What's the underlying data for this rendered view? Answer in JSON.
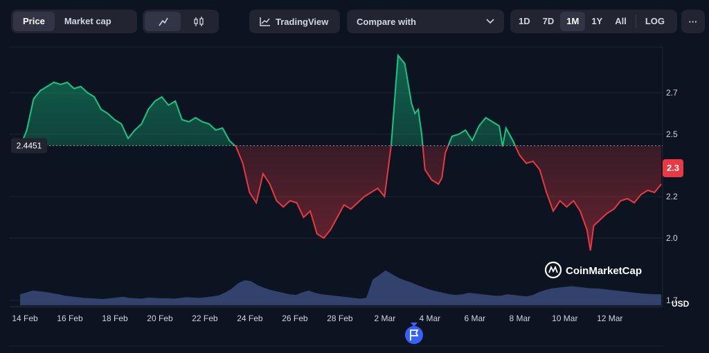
{
  "toolbar": {
    "price_label": "Price",
    "market_cap_label": "Market cap",
    "tradingview_label": "TradingView",
    "compare_placeholder": "Compare with",
    "ranges": [
      "1D",
      "7D",
      "1M",
      "1Y",
      "All"
    ],
    "active_range": "1M",
    "log_label": "LOG",
    "more_label": "···"
  },
  "colors": {
    "up": "#16c784",
    "down": "#ea3943",
    "volume": "#3a4a7a",
    "flag": "#3861fb"
  },
  "watermark": "CoinMarketCap",
  "chart_data": {
    "type": "area",
    "baseline": 2.4451,
    "baseline_label": "2.4451",
    "current_label": "2.3",
    "currency_label": "USD",
    "y_ticks": [
      2.0,
      2.2,
      2.5,
      2.7,
      1.7
    ],
    "y_tick_labels": [
      "2.0",
      "2.2",
      "2.5",
      "2.7",
      "1.7"
    ],
    "ylim": [
      1.68,
      2.92
    ],
    "x_tick_labels": [
      "14 Feb",
      "16 Feb",
      "18 Feb",
      "20 Feb",
      "22 Feb",
      "24 Feb",
      "26 Feb",
      "28 Feb",
      "2 Mar",
      "4 Mar",
      "6 Mar",
      "8 Mar",
      "10 Mar",
      "12 Mar"
    ],
    "x_range_days": [
      0,
      28.5
    ],
    "series": [
      {
        "x": [
          0,
          0.3,
          0.6,
          0.9,
          1.2,
          1.5,
          1.8,
          2.1,
          2.4,
          2.7,
          3.0,
          3.3,
          3.6,
          3.9,
          4.2,
          4.5,
          4.8,
          5.1,
          5.4,
          5.7,
          6.0,
          6.3,
          6.6,
          6.9,
          7.2,
          7.5,
          7.8,
          8.1,
          8.4,
          8.7,
          9.0,
          9.3,
          9.6,
          9.9,
          10.2,
          10.5,
          10.8,
          11.1,
          11.4,
          11.7,
          12.0,
          12.3,
          12.6,
          12.9,
          13.2,
          13.5,
          13.8,
          14.1,
          14.4,
          14.7,
          15.0,
          15.3,
          15.6,
          15.9,
          16.2,
          16.5,
          16.8,
          17.1,
          17.4,
          17.55,
          17.7,
          17.85,
          18.0,
          18.3,
          18.6,
          18.75,
          18.9,
          19.2,
          19.5,
          19.8,
          20.1,
          20.4,
          20.7,
          21.0,
          21.3,
          21.45,
          21.6,
          21.9,
          22.2,
          22.5,
          22.8,
          23.1,
          23.4,
          23.7,
          24.0,
          24.3,
          24.6,
          24.9,
          25.2,
          25.35,
          25.5,
          25.8,
          26.1,
          26.4,
          26.7,
          27.0,
          27.3,
          27.6,
          27.9,
          28.2,
          28.5
        ],
        "y": [
          2.44,
          2.52,
          2.67,
          2.71,
          2.73,
          2.75,
          2.74,
          2.75,
          2.72,
          2.73,
          2.7,
          2.68,
          2.62,
          2.6,
          2.57,
          2.55,
          2.48,
          2.52,
          2.55,
          2.62,
          2.66,
          2.68,
          2.64,
          2.66,
          2.57,
          2.56,
          2.58,
          2.56,
          2.55,
          2.52,
          2.53,
          2.47,
          2.44,
          2.36,
          2.22,
          2.17,
          2.31,
          2.26,
          2.18,
          2.15,
          2.18,
          2.17,
          2.1,
          2.13,
          2.02,
          2.0,
          2.04,
          2.1,
          2.16,
          2.14,
          2.17,
          2.2,
          2.22,
          2.24,
          2.2,
          2.45,
          2.88,
          2.84,
          2.65,
          2.6,
          2.62,
          2.5,
          2.33,
          2.28,
          2.26,
          2.29,
          2.41,
          2.49,
          2.5,
          2.52,
          2.47,
          2.54,
          2.58,
          2.56,
          2.54,
          2.44,
          2.53,
          2.47,
          2.4,
          2.36,
          2.37,
          2.33,
          2.22,
          2.13,
          2.18,
          2.15,
          2.18,
          2.13,
          2.04,
          1.94,
          2.06,
          2.09,
          2.12,
          2.14,
          2.18,
          2.19,
          2.17,
          2.21,
          2.23,
          2.22,
          2.26
        ]
      }
    ],
    "volume": [
      0.3,
      0.35,
      0.4,
      0.38,
      0.36,
      0.33,
      0.3,
      0.26,
      0.24,
      0.22,
      0.2,
      0.19,
      0.18,
      0.17,
      0.19,
      0.21,
      0.23,
      0.2,
      0.19,
      0.18,
      0.21,
      0.2,
      0.19,
      0.19,
      0.18,
      0.2,
      0.22,
      0.21,
      0.2,
      0.22,
      0.24,
      0.27,
      0.35,
      0.45,
      0.6,
      0.68,
      0.66,
      0.55,
      0.48,
      0.42,
      0.38,
      0.34,
      0.3,
      0.28,
      0.35,
      0.4,
      0.34,
      0.3,
      0.28,
      0.26,
      0.24,
      0.22,
      0.2,
      0.18,
      0.2,
      0.7,
      0.82,
      0.95,
      0.85,
      0.75,
      0.68,
      0.62,
      0.55,
      0.48,
      0.42,
      0.38,
      0.34,
      0.3,
      0.28,
      0.3,
      0.34,
      0.32,
      0.3,
      0.28,
      0.26,
      0.26,
      0.3,
      0.28,
      0.26,
      0.24,
      0.28,
      0.36,
      0.42,
      0.46,
      0.48,
      0.5,
      0.52,
      0.5,
      0.48,
      0.46,
      0.46,
      0.44,
      0.42,
      0.4,
      0.38,
      0.36,
      0.34,
      0.32,
      0.31,
      0.3,
      0.3
    ]
  }
}
